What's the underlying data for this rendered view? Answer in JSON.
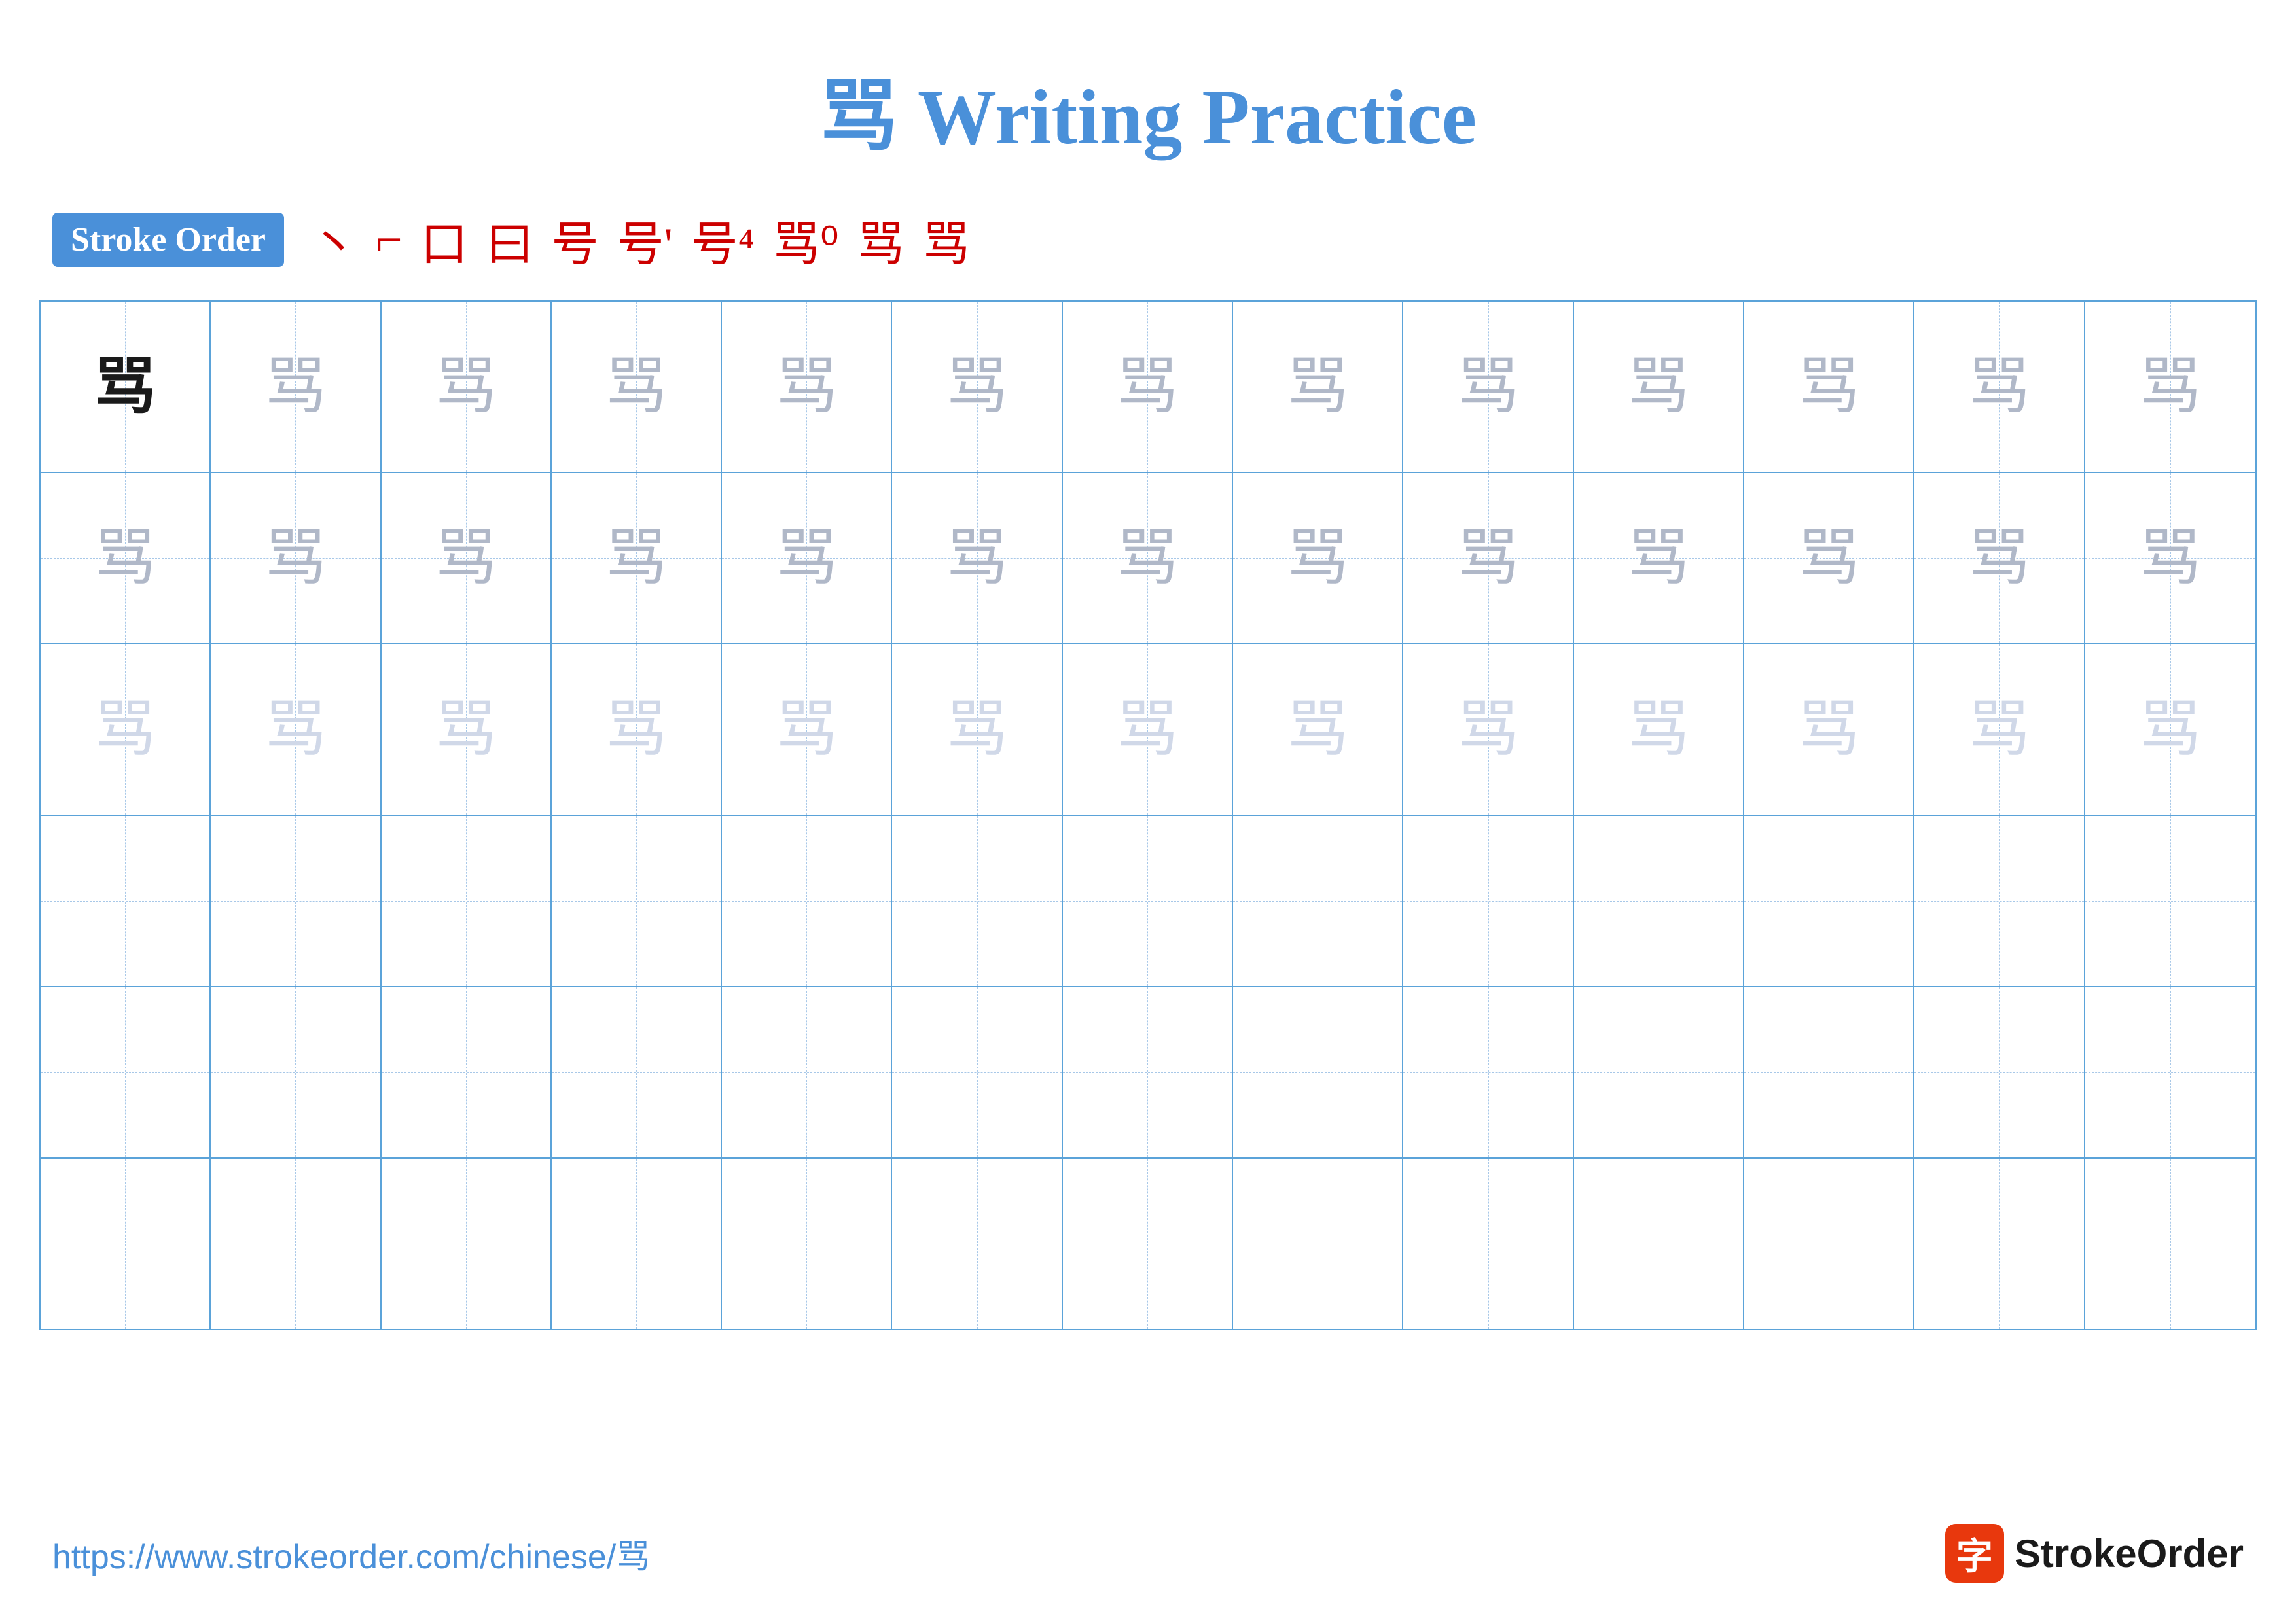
{
  "title": {
    "char": "骂",
    "text": " Writing Practice"
  },
  "stroke_order": {
    "badge_label": "Stroke Order",
    "strokes": [
      "丶",
      "ㄱ",
      "口",
      "曰",
      "号",
      "号'",
      "号⁴",
      "骂⁰",
      "骂",
      "骂"
    ]
  },
  "grid": {
    "cols": 13,
    "rows": 6,
    "char": "骂",
    "row_styles": [
      [
        "dark",
        "medium",
        "medium",
        "medium",
        "medium",
        "medium",
        "medium",
        "medium",
        "medium",
        "medium",
        "medium",
        "medium",
        "medium"
      ],
      [
        "medium",
        "medium",
        "medium",
        "medium",
        "medium",
        "medium",
        "medium",
        "medium",
        "medium",
        "medium",
        "medium",
        "medium",
        "medium"
      ],
      [
        "light",
        "light",
        "light",
        "light",
        "light",
        "light",
        "light",
        "light",
        "light",
        "light",
        "light",
        "light",
        "light"
      ],
      [
        "empty",
        "empty",
        "empty",
        "empty",
        "empty",
        "empty",
        "empty",
        "empty",
        "empty",
        "empty",
        "empty",
        "empty",
        "empty"
      ],
      [
        "empty",
        "empty",
        "empty",
        "empty",
        "empty",
        "empty",
        "empty",
        "empty",
        "empty",
        "empty",
        "empty",
        "empty",
        "empty"
      ],
      [
        "empty",
        "empty",
        "empty",
        "empty",
        "empty",
        "empty",
        "empty",
        "empty",
        "empty",
        "empty",
        "empty",
        "empty",
        "empty"
      ]
    ]
  },
  "footer": {
    "url": "https://www.strokeorder.com/chinese/骂",
    "brand_name": "StrokeOrder",
    "logo_char": "字"
  }
}
